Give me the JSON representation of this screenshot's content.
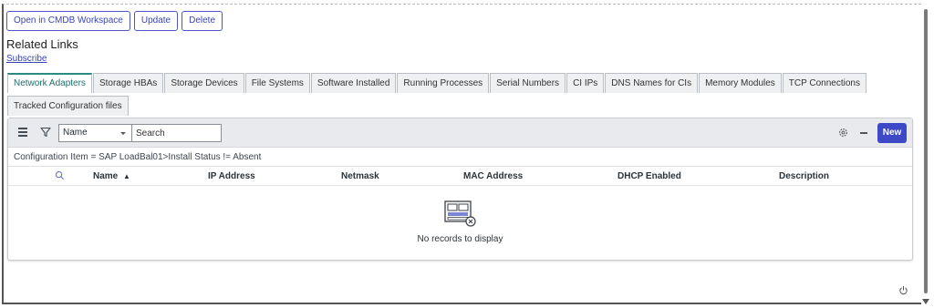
{
  "actions": {
    "open_cmdb": "Open in CMDB Workspace",
    "update": "Update",
    "delete": "Delete"
  },
  "related_links": {
    "title": "Related Links",
    "subscribe": "Subscribe"
  },
  "tabs": {
    "row1": [
      "Network Adapters",
      "Storage HBAs",
      "Storage Devices",
      "File Systems",
      "Software Installed",
      "Running Processes",
      "Serial Numbers",
      "CI IPs",
      "DNS Names for CIs",
      "Memory Modules",
      "TCP Connections"
    ],
    "row2": [
      "Tracked Configuration files"
    ],
    "active": "Network Adapters"
  },
  "toolbar": {
    "field_select": "Name",
    "search_placeholder": "Search",
    "new_label": "New"
  },
  "list": {
    "condition": "Configuration Item = SAP LoadBal01>Install Status != Absent",
    "columns": [
      "Name",
      "IP Address",
      "Netmask",
      "MAC Address",
      "DHCP Enabled",
      "Description"
    ],
    "sort_indicator": "▲",
    "empty_message": "No records to display"
  },
  "colors": {
    "accent": "#3d49c6",
    "active_tab": "#2d8a82"
  },
  "icons": [
    "hamburger-icon",
    "filter-icon",
    "gear-icon",
    "minus-icon",
    "search-icon",
    "empty-list-icon",
    "power-icon"
  ]
}
